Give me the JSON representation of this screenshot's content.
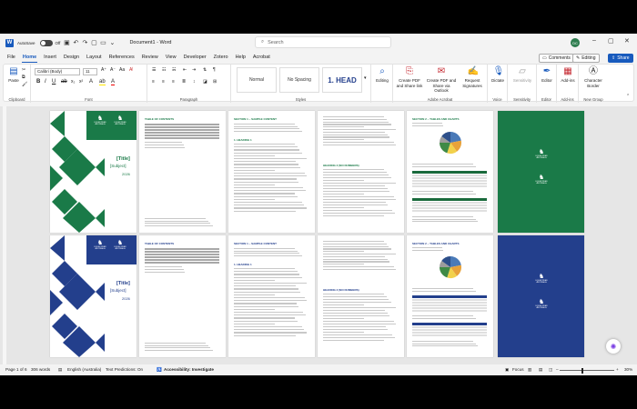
{
  "titlebar": {
    "autosave_label": "AutoSave",
    "autosave_state": "Off",
    "document_name": "Document1 - Word",
    "search_placeholder": "Search",
    "avatar_initials": "DC"
  },
  "menu": {
    "tabs": [
      "File",
      "Home",
      "Insert",
      "Design",
      "Layout",
      "References",
      "Review",
      "View",
      "Developer",
      "Zotero",
      "Help",
      "Acrobat"
    ],
    "active_tab": "Home",
    "comments_label": "Comments",
    "editing_label": "Editing",
    "share_label": "Share"
  },
  "ribbon": {
    "clipboard": {
      "paste_label": "Paste",
      "group_label": "Clipboard"
    },
    "font": {
      "font_name": "Calibri (Body)",
      "font_size": "11",
      "group_label": "Font"
    },
    "paragraph": {
      "group_label": "Paragraph"
    },
    "styles": {
      "items": [
        "Normal",
        "No Spacing",
        "1. HEAD"
      ],
      "group_label": "Styles"
    },
    "editing_label": "Editing",
    "adobe": {
      "btn1": "Create PDF and Share link",
      "btn2": "Create PDF and Share via Outlook",
      "btn3": "Request Signatures",
      "group_label": "Adobe Acrobat"
    },
    "voice": {
      "btn": "Dictate",
      "group_label": "Voice"
    },
    "sensitivity": {
      "btn": "Sensitivity",
      "group_label": "Sensitivity"
    },
    "editor": {
      "btn": "Editor",
      "group_label": "Editor"
    },
    "addins": {
      "btn": "Add-ins",
      "group_label": "Add-ins"
    },
    "newgroup": {
      "btn": "Character Border",
      "group_label": "New Group"
    }
  },
  "document": {
    "cover_title": "[Title]",
    "cover_subject": "[Subject]",
    "cover_year": "2026",
    "org_name": "EQUESTRIAN AUSTRALIA",
    "org_name_2": "EQUESTRIAN AUSTRALIA",
    "toc_heading": "TABLE OF CONTENTS",
    "section1_heading": "SECTION 1 – SAMPLE CONTENT",
    "section2_heading": "SECTION 2 – TABLES AND CHARTS",
    "heading1": "1. HEADING 1",
    "heading_numbered": "HEADING 2 (NO NUMBERS)",
    "pie_colors": [
      "#4a7ab8",
      "#e8a23a",
      "#f2d14b",
      "#3f8a46",
      "#9c9c9c",
      "#2d4f8a"
    ],
    "green": "#1a7a48",
    "blue": "#233f8c"
  },
  "statusbar": {
    "page": "Page 1 of 6",
    "words": "306 words",
    "language": "English (Australia)",
    "predictions": "Text Predictions: On",
    "accessibility": "Accessibility: Investigate",
    "focus": "Focus",
    "zoom": "30%"
  }
}
